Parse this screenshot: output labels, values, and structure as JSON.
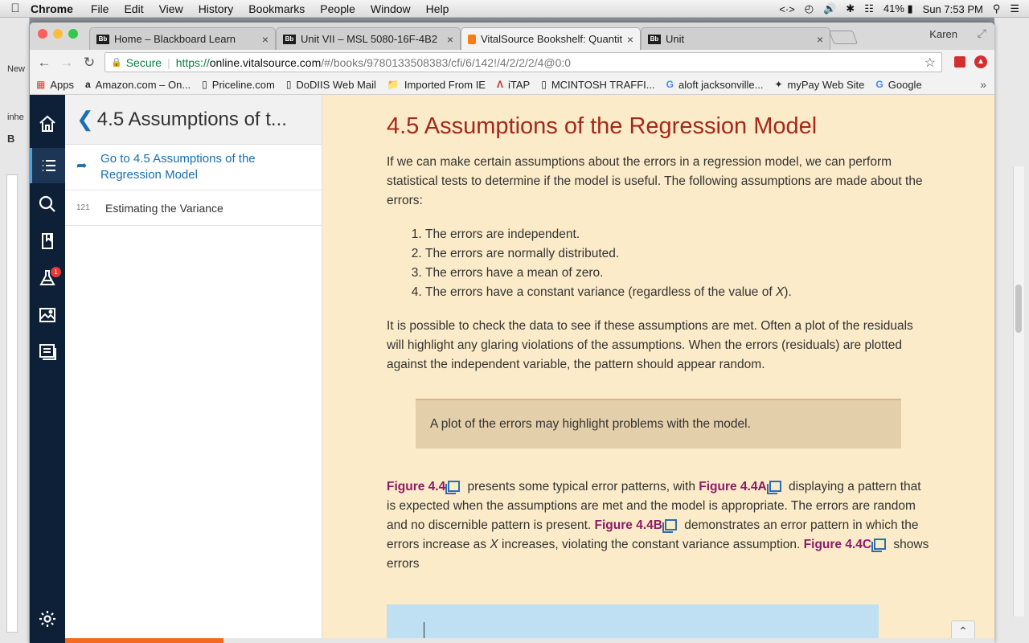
{
  "macbar": {
    "app": "Chrome",
    "menus": [
      "File",
      "Edit",
      "View",
      "History",
      "Bookmarks",
      "People",
      "Window",
      "Help"
    ],
    "battery": "41%",
    "clock": "Sun 7:53 PM"
  },
  "bg_app": {
    "label_inhe": "inhe",
    "label_new": "New",
    "label_b": "B"
  },
  "tabs": [
    {
      "title": "Home – Blackboard Learn",
      "favicon": "Bb"
    },
    {
      "title": "Unit VII – MSL 5080-16F-4B2",
      "favicon": "Bb"
    },
    {
      "title": "VitalSource Bookshelf: Quantit",
      "favicon": "vs"
    },
    {
      "title": "Unit",
      "favicon": "Bb"
    }
  ],
  "profile": "Karen",
  "address": {
    "secure_label": "Secure",
    "scheme": "https://",
    "host": "online.vitalsource.com",
    "path": "/#/books/9780133508383/cfi/6/142!/4/2/2/2/4@0:0"
  },
  "bookmarks": [
    {
      "label": "Apps",
      "icon": "apps-icon"
    },
    {
      "label": "Amazon.com – On...",
      "icon": "amazon-icon"
    },
    {
      "label": "Priceline.com",
      "icon": "page-icon"
    },
    {
      "label": "DoDIIS Web Mail",
      "icon": "page-icon"
    },
    {
      "label": "Imported From IE",
      "icon": "folder-icon"
    },
    {
      "label": "iTAP",
      "icon": "itap-icon"
    },
    {
      "label": "MCINTOSH TRAFFI...",
      "icon": "page-icon"
    },
    {
      "label": "aloft jacksonville...",
      "icon": "google-icon"
    },
    {
      "label": "myPay Web Site",
      "icon": "star-icon"
    },
    {
      "label": "Google",
      "icon": "google-icon"
    }
  ],
  "toc": {
    "title": "4.5 Assumptions of t...",
    "goto_label": "Go to 4.5 Assumptions of the Regression Model",
    "rows": [
      {
        "page": "121",
        "label": "Estimating the Variance"
      }
    ]
  },
  "rail": {
    "badge_count": "1"
  },
  "reader": {
    "heading": "4.5 Assumptions of the Regression Model",
    "intro": "If we can make certain assumptions about the errors in a regression model, we can perform statistical tests to determine if the model is useful. The following assumptions are made about the errors:",
    "list": [
      "The errors are independent.",
      "The errors are normally distributed.",
      "The errors have a mean of zero.",
      "The errors have a constant variance (regardless of the value of "
    ],
    "list_x": "X",
    "list_end": ").",
    "para2": "It is possible to check the data to see if these assumptions are met. Often a plot of the residuals will highlight any glaring violations of the assumptions. When the errors (residuals) are plotted against the independent variable, the pattern should appear random.",
    "callout": "A plot of the errors may highlight problems with the model.",
    "p3": {
      "fig_a": "Figure 4.4",
      "t1": " presents some typical error patterns, with ",
      "fig_b": "Figure 4.4A",
      "t2": " displaying a pattern that is expected when the assumptions are met and the model is appropriate. The errors are random and no discernible pattern is present. ",
      "fig_c": "Figure 4.4B",
      "t3": " demonstrates an error pattern in which the errors increase as ",
      "x": "X",
      "t4": " increases, violating the constant variance assumption. ",
      "fig_d": "Figure 4.4C",
      "t5": " shows errors"
    }
  },
  "reading_progress": 0.17
}
